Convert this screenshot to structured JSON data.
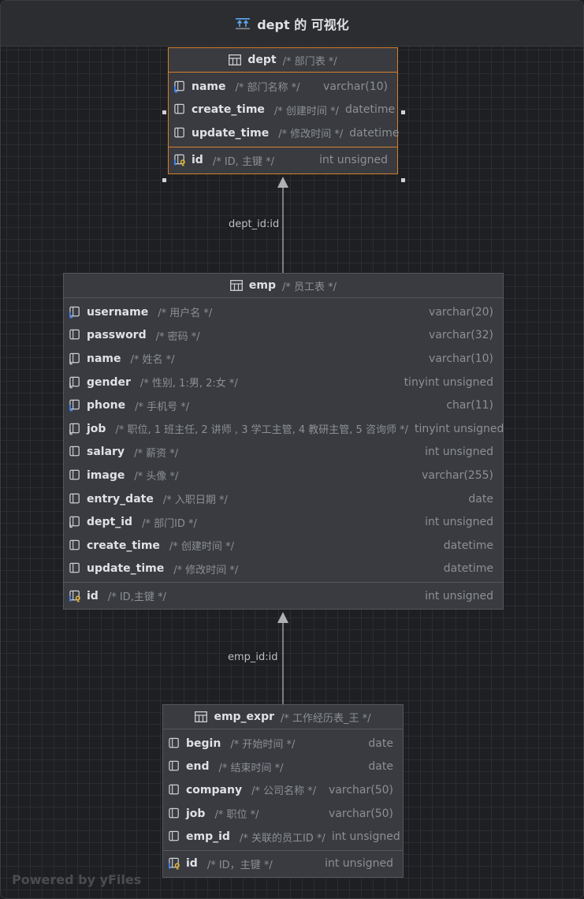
{
  "window": {
    "title": "dept 的 可视化",
    "title_icon": "diagram-icon"
  },
  "entities": {
    "dept": {
      "name": "dept",
      "comment": "/* 部门表 */",
      "columns": [
        {
          "name": "name",
          "comment": "/* 部门名称 */",
          "type": "varchar(10)",
          "icon": "index-column-icon"
        },
        {
          "name": "create_time",
          "comment": "/* 创建时间 */",
          "type": "datetime",
          "icon": "column-icon"
        },
        {
          "name": "update_time",
          "comment": "/* 修改时间 */",
          "type": "datetime",
          "icon": "column-icon"
        }
      ],
      "pk": {
        "name": "id",
        "comment": "/* ID, 主键 */",
        "type": "int unsigned",
        "icon": "primary-key-icon"
      }
    },
    "emp": {
      "name": "emp",
      "comment": "/* 员工表 */",
      "columns": [
        {
          "name": "username",
          "comment": "/* 用户名 */",
          "type": "varchar(20)",
          "icon": "index-column-icon"
        },
        {
          "name": "password",
          "comment": "/* 密码 */",
          "type": "varchar(32)",
          "icon": "column-icon"
        },
        {
          "name": "name",
          "comment": "/* 姓名 */",
          "type": "varchar(10)",
          "icon": "nullable-column-icon"
        },
        {
          "name": "gender",
          "comment": "/* 性别, 1:男, 2:女 */",
          "type": "tinyint unsigned",
          "icon": "nullable-column-icon"
        },
        {
          "name": "phone",
          "comment": "/* 手机号 */",
          "type": "char(11)",
          "icon": "index-column-icon"
        },
        {
          "name": "job",
          "comment": "/* 职位, 1 班主任, 2 讲师 , 3 学工主管, 4 教研主管, 5 咨询师 */",
          "type": "tinyint unsigned",
          "icon": "nullable-column-icon"
        },
        {
          "name": "salary",
          "comment": "/* 薪资 */",
          "type": "int unsigned",
          "icon": "column-icon"
        },
        {
          "name": "image",
          "comment": "/* 头像 */",
          "type": "varchar(255)",
          "icon": "column-icon"
        },
        {
          "name": "entry_date",
          "comment": "/* 入职日期 */",
          "type": "date",
          "icon": "column-icon"
        },
        {
          "name": "dept_id",
          "comment": "/* 部门ID */",
          "type": "int unsigned",
          "icon": "nullable-column-icon"
        },
        {
          "name": "create_time",
          "comment": "/* 创建时间 */",
          "type": "datetime",
          "icon": "column-icon"
        },
        {
          "name": "update_time",
          "comment": "/* 修改时间 */",
          "type": "datetime",
          "icon": "column-icon"
        }
      ],
      "pk": {
        "name": "id",
        "comment": "/* ID,主键 */",
        "type": "int unsigned",
        "icon": "primary-key-icon"
      }
    },
    "emp_expr": {
      "name": "emp_expr",
      "comment": "/* 工作经历表_王 */",
      "columns": [
        {
          "name": "begin",
          "comment": "/* 开始时间 */",
          "type": "date",
          "icon": "column-icon"
        },
        {
          "name": "end",
          "comment": "/* 结束时间 */",
          "type": "date",
          "icon": "column-icon"
        },
        {
          "name": "company",
          "comment": "/* 公司名称 */",
          "type": "varchar(50)",
          "icon": "column-icon"
        },
        {
          "name": "job",
          "comment": "/* 职位 */",
          "type": "varchar(50)",
          "icon": "column-icon"
        },
        {
          "name": "emp_id",
          "comment": "/* 关联的员工ID */",
          "type": "int unsigned",
          "icon": "column-icon"
        }
      ],
      "pk": {
        "name": "id",
        "comment": "/* ID，主键 */",
        "type": "int unsigned",
        "icon": "primary-key-icon"
      }
    }
  },
  "relations": [
    {
      "label": "dept_id:id",
      "from": "emp",
      "to": "dept"
    },
    {
      "label": "emp_id:id",
      "from": "emp_expr",
      "to": "emp"
    }
  ],
  "watermark": "Powered by yFiles",
  "colors": {
    "selected_border": "#d67f2e",
    "key_icon": "#e0b535",
    "index_icon": "#3d7ff0"
  }
}
